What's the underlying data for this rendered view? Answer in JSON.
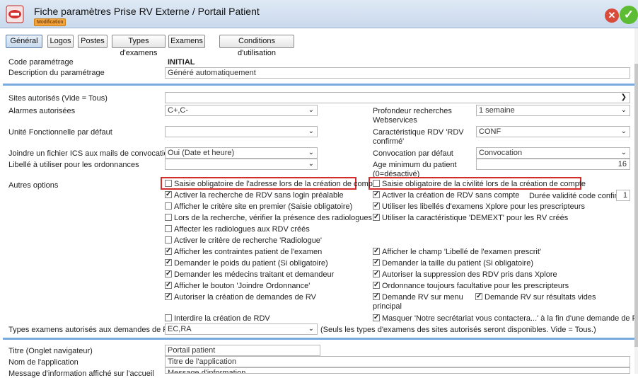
{
  "window": {
    "title": "Fiche paramètres Prise RV Externe / Portail Patient",
    "mode_badge": "Modification"
  },
  "tabs": [
    "Général",
    "Logos",
    "Postes",
    "Types d'examens",
    "Examens",
    "Conditions d'utilisation"
  ],
  "general": {
    "code_label": "Code paramétrage",
    "code_value": "INITIAL",
    "description_label": "Description du paramétrage",
    "description_value": "Généré automatiquement"
  },
  "sites": {
    "label": "Sites autorisés (Vide = Tous)",
    "value": ""
  },
  "alarmes": {
    "label": "Alarmes autorisées",
    "value": "C+,C-"
  },
  "profondeur": {
    "label": "Profondeur recherches Webservices",
    "value": "1 semaine"
  },
  "uf": {
    "label": "Unité Fonctionnelle par défaut",
    "value": ""
  },
  "caracteristique": {
    "label": "Caractéristique RDV 'RDV confirmé'",
    "value": "CONF"
  },
  "ics": {
    "label": "Joindre un fichier ICS aux mails de convocation",
    "value": "Oui (Date et heure)"
  },
  "convocation": {
    "label": "Convocation par défaut",
    "value": "Convocation"
  },
  "ordonnances": {
    "label": "Libellé à utiliser pour les ordonnances",
    "value": ""
  },
  "age_min": {
    "label": "Age minimum du patient (0=désactivé)",
    "value": "16"
  },
  "autres_options_label": "Autres options",
  "options_left": [
    {
      "label": "Saisie obligatoire de l'adresse lors de la création de compte",
      "checked": false
    },
    {
      "label": "Activer la recherche de RDV sans login préalable",
      "checked": true
    },
    {
      "label": "Afficher le critère site en premier (Saisie obligatoire)",
      "checked": false
    },
    {
      "label": "Lors de la recherche, vérifier la présence des radiologues",
      "checked": false
    },
    {
      "label": "Affecter les radiologues aux RDV créés",
      "checked": false
    },
    {
      "label": "Activer le critère de recherche 'Radiologue'",
      "checked": false
    },
    {
      "label": "Afficher les contraintes patient de l'examen",
      "checked": true
    },
    {
      "label": "Demander le poids du patient (Si obligatoire)",
      "checked": true
    },
    {
      "label": "Demander les médecins traitant et demandeur",
      "checked": true
    },
    {
      "label": "Afficher le bouton 'Joindre Ordonnance'",
      "checked": true
    },
    {
      "label": "Autoriser la création de demandes de RV",
      "checked": true
    },
    {
      "label": "Interdire la création de RDV",
      "checked": false
    }
  ],
  "options_right": [
    {
      "label": "Saisie obligatoire de la civilité lors de la création de compte",
      "checked": false
    },
    {
      "label": "Activer la création de RDV sans compte",
      "checked": true
    },
    {
      "label": "Utiliser les libellés d'examens Xplore pour les prescripteurs",
      "checked": true
    },
    {
      "label": "Utiliser la caractéristique 'DEMEXT' pour les RV créés",
      "checked": true
    },
    {
      "label": "Afficher le champ 'Libellé de l'examen prescrit'",
      "checked": true
    },
    {
      "label": "Demander la taille du patient (Si obligatoire)",
      "checked": true
    },
    {
      "label": "Autoriser la suppression des RDV pris dans Xplore",
      "checked": true
    },
    {
      "label": "Ordonnance toujours facultative pour les prescripteurs",
      "checked": true
    },
    {
      "label": "Demande RV sur menu principal",
      "checked": true
    },
    {
      "label": "Demande RV sur résultats vides",
      "checked": true
    },
    {
      "label": "Masquer 'Notre secrétariat vous contactera...' à la fin d'une demande de RV",
      "checked": true
    }
  ],
  "duree_validite": {
    "label": "Durée validité code confirm.",
    "value": "1"
  },
  "types_examens": {
    "label": "Types examens autorisés aux demandes de RV",
    "value": "EC,RA",
    "note": "(Seuls les types d'examens des sites autorisés seront disponibles. Vide = Tous.)"
  },
  "portail": {
    "titre_label": "Titre (Onglet navigateur)",
    "titre_value": "Portail patient",
    "nom_label": "Nom de l'application",
    "nom_value": "Titre de l'application",
    "message_label": "Message d'information affiché sur l'accueil",
    "message_value": "Message d'information"
  },
  "colors": {
    "highlight": "#d42b2b",
    "separator": "#79aadd",
    "close": "#d84b3a",
    "ok": "#5cbc34"
  }
}
